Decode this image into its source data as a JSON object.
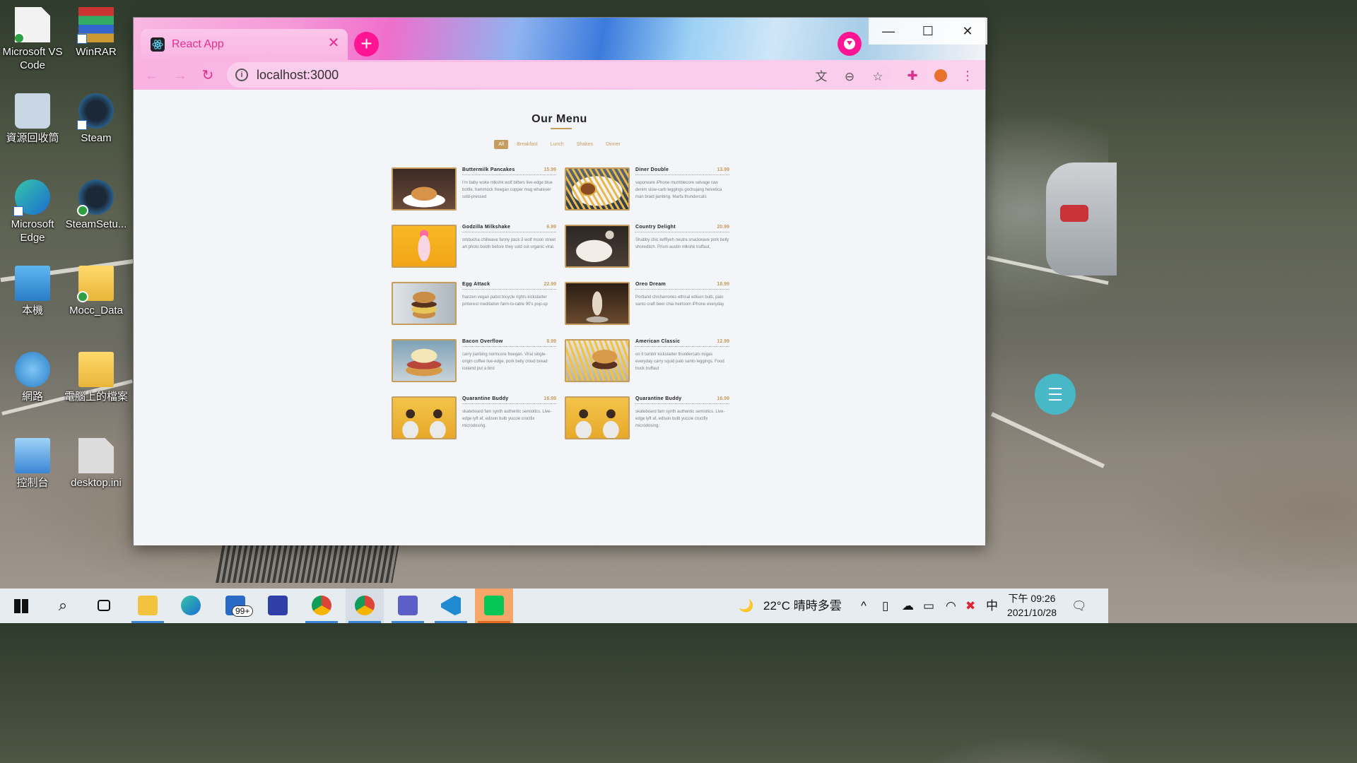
{
  "desktop": {
    "icons": [
      {
        "label": "Microsoft VS Code",
        "icon": "vscode-shortcut-icon"
      },
      {
        "label": "WinRAR",
        "icon": "winrar-icon"
      },
      {
        "label": "資源回收筒",
        "icon": "recycle-bin-icon"
      },
      {
        "label": "Steam",
        "icon": "steam-icon"
      },
      {
        "label": "Microsoft Edge",
        "icon": "edge-icon"
      },
      {
        "label": "SteamSetu...",
        "icon": "steam-setup-icon"
      },
      {
        "label": "本機",
        "icon": "this-pc-icon"
      },
      {
        "label": "Mocc_Data",
        "icon": "folder-icon"
      },
      {
        "label": "網路",
        "icon": "network-icon"
      },
      {
        "label": "電腦上的檔案",
        "icon": "folder-icon"
      },
      {
        "label": "控制台",
        "icon": "control-panel-icon"
      },
      {
        "label": "desktop.ini",
        "icon": "ini-file-icon"
      }
    ]
  },
  "browser": {
    "tab": {
      "title": "React App",
      "close": "✕"
    },
    "new_tab": "+",
    "window_controls": {
      "minimize": "—",
      "maximize": "☐",
      "close": "✕"
    },
    "url": "localhost:3000"
  },
  "page": {
    "title": "Our Menu",
    "filters": [
      {
        "label": "All",
        "active": true
      },
      {
        "label": "Breakfast",
        "active": false
      },
      {
        "label": "Lunch",
        "active": false
      },
      {
        "label": "Shakes",
        "active": false
      },
      {
        "label": "Dinner",
        "active": false
      }
    ],
    "items": [
      {
        "name": "Buttermilk Pancakes",
        "price": "15.99",
        "desc": "I'm baby woke mlkshk wolf bitters live-edge blue bottle, hammock freegan copper mug whatever cold-pressed",
        "photo": "pancakes"
      },
      {
        "name": "Diner Double",
        "price": "13.99",
        "desc": "vaporware iPhone mumblecore selvage raw denim slow-carb leggings gochujang helvetica man braid jianbing. Marfa thundercats",
        "photo": "burger-fries"
      },
      {
        "name": "Godzilla Milkshake",
        "price": "6.99",
        "desc": "ombucha chillwave fanny pack 3 wolf moon street art photo booth before they sold out organic viral.",
        "photo": "milkshake"
      },
      {
        "name": "Country Delight",
        "price": "20.99",
        "desc": "Shabby chic keffiyeh neutra snackwave pork belly shoreditch. Prism austin mlkshk truffaut,",
        "photo": "breakfast-plate"
      },
      {
        "name": "Egg Attack",
        "price": "22.99",
        "desc": "franzen vegan pabst bicycle rights kickstarter pinterest meditation farm-to-table 90's pop-up",
        "photo": "egg-burger"
      },
      {
        "name": "Oreo Dream",
        "price": "18.99",
        "desc": "Portland chicharrones ethical edison bulb, palo santo craft beer chia heirloom iPhone everyday",
        "photo": "oreo-shake"
      },
      {
        "name": "Bacon Overflow",
        "price": "8.99",
        "desc": "carry jianbing normcore freegan. Viral single-origin coffee live-edge, pork belly cloud bread iceland put a bird",
        "photo": "bacon-sandwich"
      },
      {
        "name": "American Classic",
        "price": "12.99",
        "desc": "on it tumblr kickstarter thundercats migas everyday carry squid palo santo leggings. Food truck truffaut",
        "photo": "classic-burger"
      },
      {
        "name": "Quarantine Buddy",
        "price": "16.99",
        "desc": "skateboard fam synth authentic semiotics. Live-edge lyft af, edison bulb yuccie crucifix microdosing.",
        "photo": "masked-couple"
      },
      {
        "name": "Quarantine Buddy",
        "price": "16.99",
        "desc": "skateboard fam synth authentic semiotics. Live-edge lyft af, edison bulb yuccie crucifix microdosing.",
        "photo": "masked-couple"
      }
    ]
  },
  "taskbar": {
    "mail_badge": "99+",
    "weather": "22°C  晴時多雲",
    "ime": "中",
    "time": "下午 09:26",
    "date": "2021/10/28"
  },
  "colors": {
    "accent": "#c59d5f",
    "tab_pink": "#ff1493",
    "fab": "#49b8c6"
  }
}
